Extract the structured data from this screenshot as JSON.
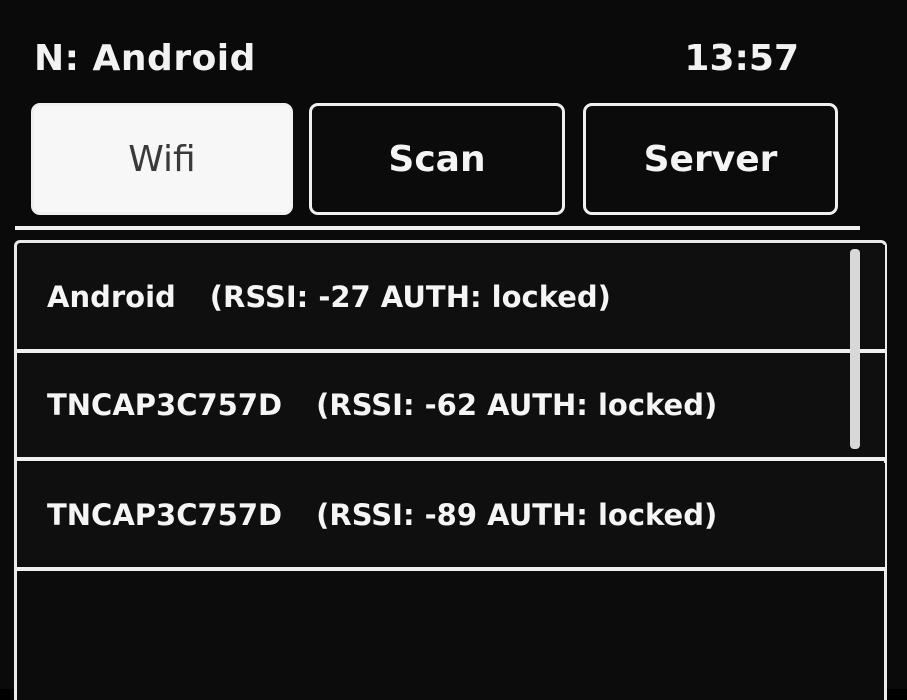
{
  "header": {
    "network_label": "N: Android",
    "time": "13:57"
  },
  "tabs": [
    {
      "label": "Wifi",
      "active": true
    },
    {
      "label": "Scan",
      "active": false
    },
    {
      "label": "Server",
      "active": false
    }
  ],
  "networks": [
    {
      "ssid": "Android",
      "info": "(RSSI: -27 AUTH: locked)"
    },
    {
      "ssid": "TNCAP3C757D",
      "info": "(RSSI: -62 AUTH: locked)"
    },
    {
      "ssid": "TNCAP3C757D",
      "info": "(RSSI: -89 AUTH: locked)"
    }
  ],
  "colors": {
    "background": "#0a0a0a",
    "border": "#f0f0f0",
    "active_tab_bg": "#f7f7f7",
    "active_tab_text": "#3a3a3a",
    "text": "#f5f5f5"
  }
}
